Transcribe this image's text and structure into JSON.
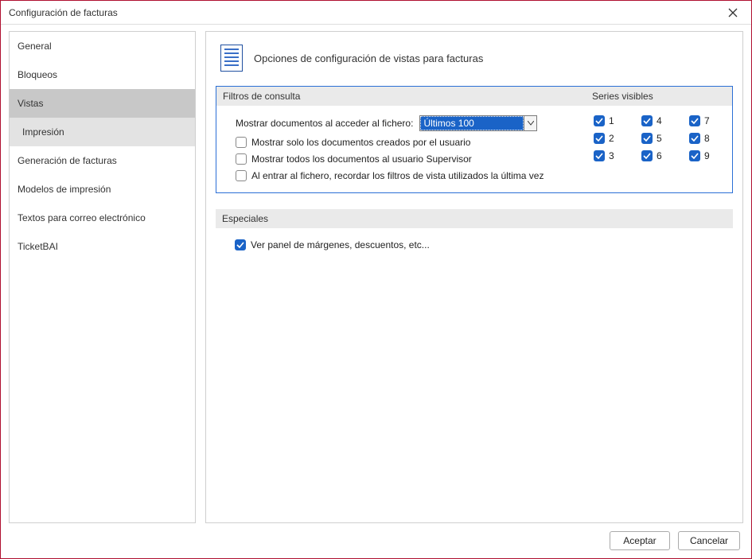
{
  "window": {
    "title": "Configuración de facturas"
  },
  "sidebar": {
    "items": [
      {
        "label": "General"
      },
      {
        "label": "Bloqueos"
      },
      {
        "label": "Vistas"
      },
      {
        "label": "Impresión"
      },
      {
        "label": "Generación de facturas"
      },
      {
        "label": "Modelos de impresión"
      },
      {
        "label": "Textos para correo electrónico"
      },
      {
        "label": "TicketBAI"
      }
    ]
  },
  "content": {
    "title": "Opciones de configuración de vistas para facturas",
    "filters_head": "Filtros de consulta",
    "series_head": "Series visibles",
    "especiales_head": "Especiales",
    "show_docs_label": "Mostrar documentos al acceder al fichero:",
    "combo_value": "Últimos 100",
    "chk_only_user": "Mostrar solo los documentos creados por el usuario",
    "chk_supervisor": "Mostrar todos los documentos al usuario Supervisor",
    "chk_remember": "Al entrar al fichero, recordar los filtros de vista utilizados la última vez",
    "series": {
      "s1": "1",
      "s2": "2",
      "s3": "3",
      "s4": "4",
      "s5": "5",
      "s6": "6",
      "s7": "7",
      "s8": "8",
      "s9": "9"
    },
    "chk_margenes": "Ver panel de márgenes, descuentos, etc..."
  },
  "footer": {
    "accept": "Aceptar",
    "cancel": "Cancelar"
  }
}
